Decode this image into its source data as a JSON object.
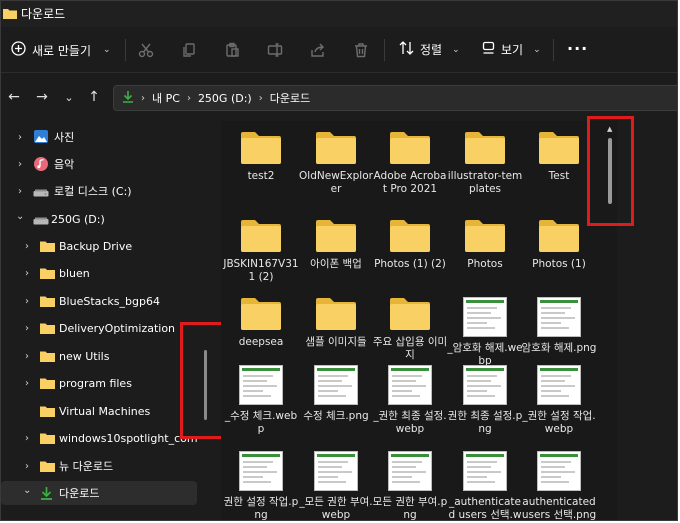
{
  "window": {
    "title": "다운로드"
  },
  "commandbar": {
    "new_label": "새로 만들기",
    "sort_label": "정렬",
    "view_label": "보기",
    "more_label": "···"
  },
  "address": {
    "crumbs": [
      "내 PC",
      "250G (D:)",
      "다운로드"
    ]
  },
  "sidebar": {
    "items": [
      {
        "label": "사진",
        "icon": "pictures-icon"
      },
      {
        "label": "음악",
        "icon": "music-icon"
      },
      {
        "label": "로컬 디스크 (C:)",
        "icon": "drive-icon"
      },
      {
        "label": "250G (D:)",
        "icon": "drive-icon"
      },
      {
        "label": "Backup Drive",
        "icon": "folder-icon"
      },
      {
        "label": "bluen",
        "icon": "folder-icon"
      },
      {
        "label": "BlueStacks_bgp64",
        "icon": "folder-icon"
      },
      {
        "label": "DeliveryOptimization",
        "icon": "folder-icon"
      },
      {
        "label": "new Utils",
        "icon": "folder-icon"
      },
      {
        "label": "program files",
        "icon": "folder-icon"
      },
      {
        "label": "Virtual Machines",
        "icon": "folder-icon"
      },
      {
        "label": "windows10spotlight_com",
        "icon": "folder-icon"
      },
      {
        "label": "뉴 다운로드",
        "icon": "folder-icon"
      },
      {
        "label": "다운로드",
        "icon": "download-icon"
      }
    ]
  },
  "files": [
    {
      "name": "test2",
      "kind": "folder"
    },
    {
      "name": "OldNewExplorer",
      "kind": "folder"
    },
    {
      "name": "Adobe Acrobat Pro 2021",
      "kind": "folder"
    },
    {
      "name": "illustrator-templates",
      "kind": "folder"
    },
    {
      "name": "Test",
      "kind": "folder"
    },
    {
      "name": "JBSKIN167V311 (2)",
      "kind": "folder"
    },
    {
      "name": "아이폰 백업",
      "kind": "folder"
    },
    {
      "name": "Photos (1) (2)",
      "kind": "folder"
    },
    {
      "name": "Photos",
      "kind": "folder"
    },
    {
      "name": "Photos (1)",
      "kind": "folder"
    },
    {
      "name": "deepsea",
      "kind": "folder"
    },
    {
      "name": "샘플 이미지들",
      "kind": "folder"
    },
    {
      "name": "주요 삽입용 이미지",
      "kind": "folder"
    },
    {
      "name": "_암호화 해제.webp",
      "kind": "image"
    },
    {
      "name": "암호화 해제.png",
      "kind": "image"
    },
    {
      "name": "_수정 체크.webp",
      "kind": "image"
    },
    {
      "name": "수정 체크.png",
      "kind": "image"
    },
    {
      "name": "_권한 최종 설정.webp",
      "kind": "image"
    },
    {
      "name": "권한 최종 설정.png",
      "kind": "image"
    },
    {
      "name": "_권한 설정 작업.webp",
      "kind": "image"
    },
    {
      "name": "권한 설정 작업.png",
      "kind": "image"
    },
    {
      "name": "_모든 권한 부여.webp",
      "kind": "image"
    },
    {
      "name": "모든 권한 부여.png",
      "kind": "image"
    },
    {
      "name": "_authenticated users 선택.webp",
      "kind": "image"
    },
    {
      "name": "authenticated users 선택.png",
      "kind": "image"
    }
  ],
  "colors": {
    "window_bg": "#1c1c1c",
    "folder_yellow": "#f8d063",
    "highlight_red": "#e01b1b",
    "download_green": "#3cb043"
  }
}
